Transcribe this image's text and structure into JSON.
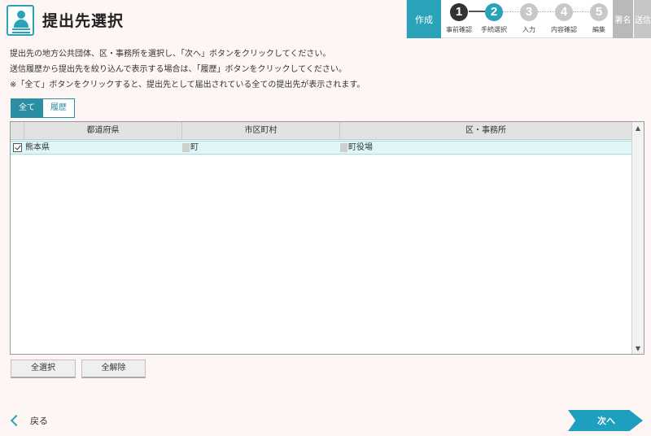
{
  "header": {
    "title": "提出先選択",
    "icon": "person-document-icon"
  },
  "steps": {
    "current_label": "作成",
    "items": [
      {
        "number": "1",
        "label": "事前確認",
        "state": "done",
        "color": "#333333"
      },
      {
        "number": "2",
        "label": "手続選択",
        "state": "current",
        "color": "#2aa3b8"
      },
      {
        "number": "3",
        "label": "入力",
        "state": "todo",
        "color": "#c8c8c8"
      },
      {
        "number": "4",
        "label": "内容確認",
        "state": "todo",
        "color": "#c8c8c8"
      },
      {
        "number": "5",
        "label": "編集",
        "state": "todo",
        "color": "#c8c8c8"
      }
    ],
    "sign_label": "署名",
    "send_label": "送信"
  },
  "instructions": {
    "line1": "提出先の地方公共団体、区・事務所を選択し、「次へ」ボタンをクリックしてください。",
    "line2": "送信履歴から提出先を絞り込んで表示する場合は、「履歴」ボタンをクリックしてください。",
    "line3": "※「全て」ボタンをクリックすると、提出先として届出されている全ての提出先が表示されます。"
  },
  "tabs": {
    "all": "全て",
    "history": "履歴"
  },
  "table": {
    "headers": [
      "都道府県",
      "市区町村",
      "区・事務所"
    ],
    "rows": [
      {
        "checked": true,
        "prefecture": "熊本県",
        "city": "町",
        "office": "町役場"
      }
    ]
  },
  "buttons": {
    "select_all": "全選択",
    "deselect_all": "全解除",
    "back": "戻る",
    "next": "次へ"
  },
  "colors": {
    "accent": "#2aa3b8",
    "next_button": "#1e9fc0",
    "selected_row": "#dff7f9"
  }
}
